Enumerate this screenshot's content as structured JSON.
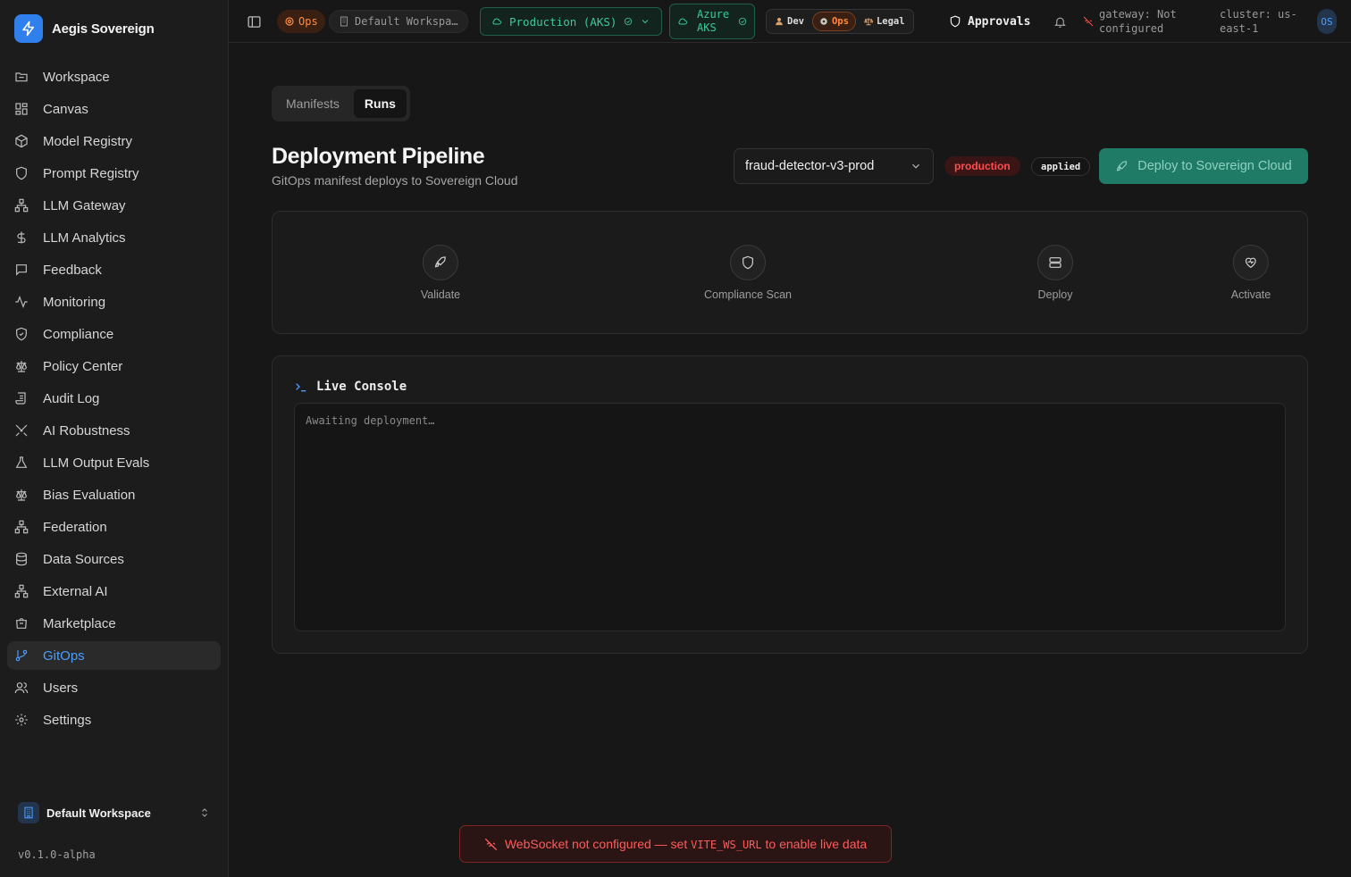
{
  "brand": {
    "name": "Aegis Sovereign"
  },
  "sidebar": {
    "items": [
      {
        "label": "Workspace",
        "icon": "folder-icon"
      },
      {
        "label": "Canvas",
        "icon": "grid-icon"
      },
      {
        "label": "Model Registry",
        "icon": "cube-icon"
      },
      {
        "label": "Prompt Registry",
        "icon": "shield-icon"
      },
      {
        "label": "LLM Gateway",
        "icon": "network-icon"
      },
      {
        "label": "LLM Analytics",
        "icon": "dollar-icon"
      },
      {
        "label": "Feedback",
        "icon": "message-icon"
      },
      {
        "label": "Monitoring",
        "icon": "activity-icon"
      },
      {
        "label": "Compliance",
        "icon": "shield-check-icon"
      },
      {
        "label": "Policy Center",
        "icon": "scale-icon"
      },
      {
        "label": "Audit Log",
        "icon": "scroll-icon"
      },
      {
        "label": "AI Robustness",
        "icon": "swords-icon"
      },
      {
        "label": "LLM Output Evals",
        "icon": "flask-icon"
      },
      {
        "label": "Bias Evaluation",
        "icon": "scale-icon"
      },
      {
        "label": "Federation",
        "icon": "network-icon"
      },
      {
        "label": "Data Sources",
        "icon": "database-icon"
      },
      {
        "label": "External AI",
        "icon": "network-icon"
      },
      {
        "label": "Marketplace",
        "icon": "store-icon"
      },
      {
        "label": "GitOps",
        "icon": "git-branch-icon"
      },
      {
        "label": "Users",
        "icon": "users-icon"
      },
      {
        "label": "Settings",
        "icon": "gear-icon"
      }
    ],
    "active_index": 18,
    "workspace_label": "Default Workspace",
    "version": "v0.1.0-alpha"
  },
  "topbar": {
    "ops_badge": "Ops",
    "workspace_crumb": "Default Workspa…",
    "environment": "Production (AKS)",
    "cloud_line1": "Azure",
    "cloud_line2": "AKS",
    "personas": [
      "Dev",
      "Ops",
      "Legal"
    ],
    "selected_persona": "Ops",
    "approvals_label": "Approvals",
    "gateway_line1": "gateway: Not",
    "gateway_line2": "configured",
    "cluster_line1": "cluster: us-",
    "cluster_line2": "east-1",
    "avatar_initials": "OS"
  },
  "tabs": [
    {
      "label": "Manifests",
      "selected": false
    },
    {
      "label": "Runs",
      "selected": true
    }
  ],
  "header": {
    "title": "Deployment Pipeline",
    "subtitle": "GitOps manifest deploys to Sovereign Cloud",
    "manifest_selected": "fraud-detector-v3-prod",
    "env_badge": "production",
    "status_badge": "applied",
    "deploy_label": "Deploy to Sovereign Cloud"
  },
  "pipeline": {
    "stages": [
      {
        "label": "Validate",
        "icon": "rocket-icon"
      },
      {
        "label": "Compliance Scan",
        "icon": "shield-icon"
      },
      {
        "label": "Deploy",
        "icon": "server-icon"
      },
      {
        "label": "Activate",
        "icon": "heart-pulse-icon"
      }
    ]
  },
  "console": {
    "title": "Live Console",
    "placeholder": "Awaiting deployment…"
  },
  "toast": {
    "prefix": "WebSocket not configured — set ",
    "code": "VITE_WS_URL",
    "suffix": " to enable live data"
  },
  "colors": {
    "accent": "#4a9eff",
    "ops": "#ff8a3d",
    "success": "#3fc79a",
    "danger": "#ff4d4d",
    "deploy_button": "#1f7a66"
  }
}
